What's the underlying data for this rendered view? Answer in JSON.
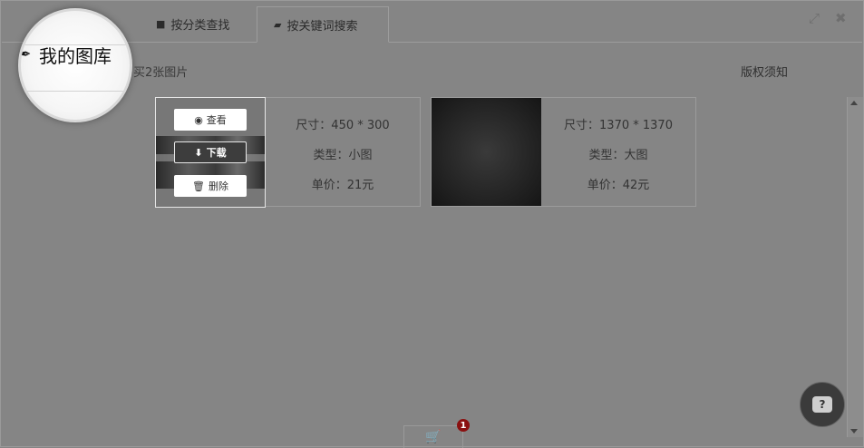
{
  "tabs": [
    {
      "icon": "folder-icon",
      "label": "按分类查找"
    },
    {
      "icon": "folder-open-icon",
      "label": "按关键词搜索"
    }
  ],
  "page_title": "我的图库",
  "summary": "买2张图片",
  "rights_link": "版权须知",
  "cards": [
    {
      "size": "尺寸：450 * 300",
      "type": "类型：小图",
      "price": "单价：21元",
      "actions": {
        "view": "查看",
        "download": "下载",
        "delete": "删除"
      }
    },
    {
      "size": "尺寸：1370 * 1370",
      "type": "类型：大图",
      "price": "单价：42元"
    }
  ],
  "cart": {
    "badge": "1"
  },
  "help": {
    "label": "?"
  }
}
